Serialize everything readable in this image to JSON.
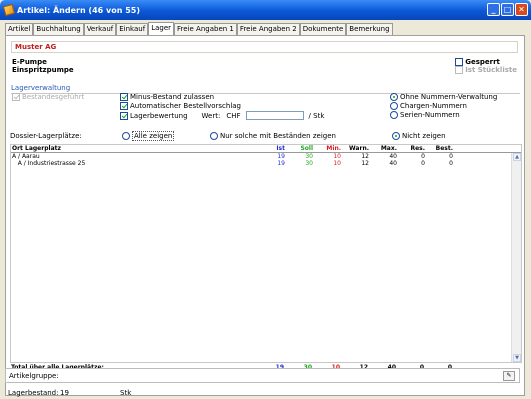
{
  "window": {
    "title": "Artikel: Ändern (46 von 55)"
  },
  "tabs": [
    {
      "label": "Artikel"
    },
    {
      "label": "Buchhaltung"
    },
    {
      "label": "Verkauf"
    },
    {
      "label": "Einkauf"
    },
    {
      "label": "Lager"
    },
    {
      "label": "Freie Angaben 1"
    },
    {
      "label": "Freie Angaben 2"
    },
    {
      "label": "Dokumente"
    },
    {
      "label": "Bemerkung"
    }
  ],
  "active_tab": "Lager",
  "supplier": "Muster AG",
  "article": {
    "line1": "E-Pumpe",
    "line2": "Einspritzpumpe"
  },
  "flags": {
    "gesperrt": "Gesperrt",
    "stueckliste": "Ist Stückliste"
  },
  "lager": {
    "section_title": "Lagerverwaltung",
    "bestandesgefuehrt": "Bestandesgeführt",
    "minus_bestand": "Minus-Bestand zulassen",
    "auto_bestell": "Automatischer Bestellvorschlag",
    "bewertung": "Lagerbewertung",
    "wert_label": "Wert:",
    "currency": "CHF",
    "per_unit": "/ Stk",
    "nummern": [
      {
        "label": "Ohne Nummern-Verwaltung",
        "selected": true
      },
      {
        "label": "Chargen-Nummern",
        "selected": false
      },
      {
        "label": "Serien-Nummern",
        "selected": false
      }
    ]
  },
  "dossier": {
    "label": "Dossier-Lagerplätze:",
    "options": [
      {
        "label": "Alle zeigen",
        "selected": false
      },
      {
        "label": "Nur solche mit Beständen zeigen",
        "selected": false
      },
      {
        "label": "Nicht zeigen",
        "selected": true
      }
    ]
  },
  "table": {
    "headers": [
      "Ort Lagerplatz",
      "Ist",
      "Soll",
      "Min.",
      "Warn.",
      "Max.",
      "Res.",
      "Best."
    ],
    "rows": [
      {
        "ort": "A / Aarau",
        "ist": "19",
        "soll": "30",
        "min": "10",
        "warn": "12",
        "max": "40",
        "res": "0",
        "best": "0"
      },
      {
        "ort": "   A / Industriestrasse 25",
        "ist": "19",
        "soll": "30",
        "min": "10",
        "warn": "12",
        "max": "40",
        "res": "0",
        "best": "0"
      }
    ],
    "total": {
      "label": "Total über alle Lagerplätze:",
      "ist": "19",
      "soll": "30",
      "min": "10",
      "warn": "12",
      "max": "40",
      "res": "0",
      "best": "0"
    }
  },
  "artikelgruppe": {
    "label": "Artikelgruppe:"
  },
  "status": {
    "label": "Lagerbestand:",
    "value": "19",
    "unit": "Stk"
  },
  "colors": {
    "ist": "#1d2fd4",
    "soll": "#19a519",
    "min": "#d41d1d",
    "accent": "#2a5bb5"
  }
}
